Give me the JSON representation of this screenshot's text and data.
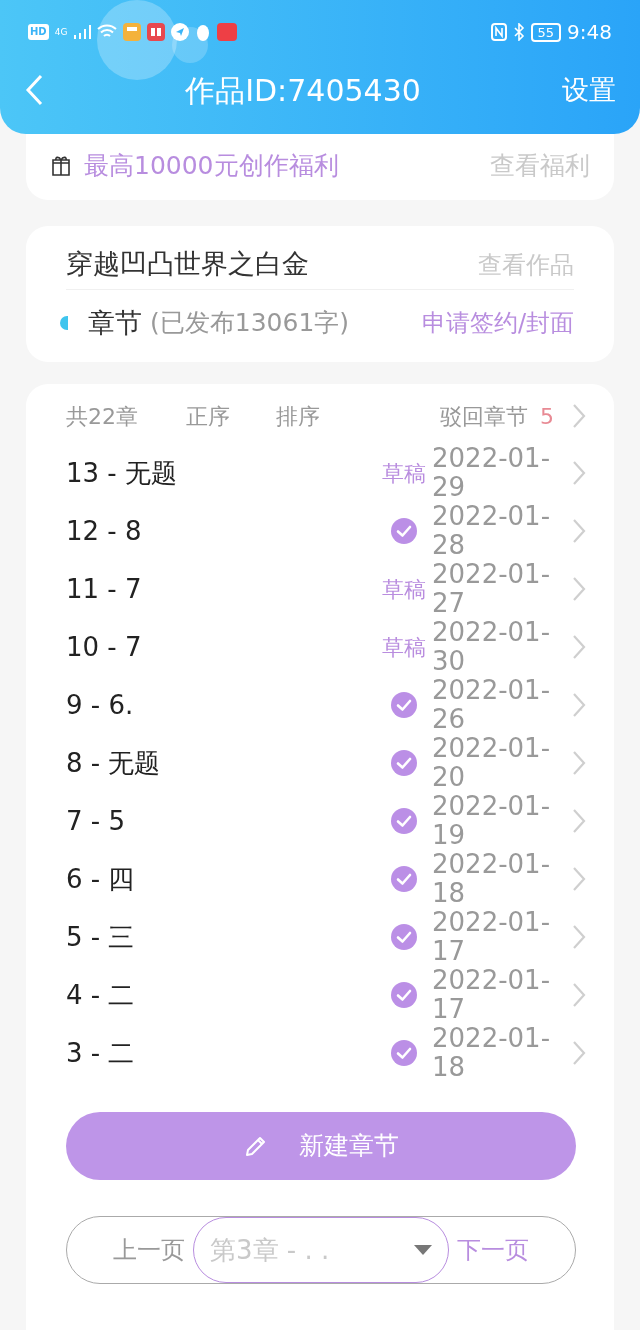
{
  "status_bar": {
    "time": "9:48",
    "battery": "55",
    "network": "4G",
    "hd": "HD"
  },
  "header": {
    "title": "作品ID:7405430",
    "action": "设置"
  },
  "benefit": {
    "text": "最高10000元创作福利",
    "link": "查看福利"
  },
  "work": {
    "title": "穿越凹凸世界之白金",
    "link": "查看作品",
    "section": "章节",
    "published": "(已发布13061字)",
    "apply": "申请签约/封面"
  },
  "chapters_bar": {
    "count": "共22章",
    "order": "正序",
    "sort": "排序",
    "rejected": "驳回章节",
    "rejected_count": "5"
  },
  "chapters": [
    {
      "title": "13 - 无题",
      "kind": "draft",
      "status": "草稿",
      "date": "2022-01-29"
    },
    {
      "title": "12 - 8",
      "kind": "published",
      "date": "2022-01-28"
    },
    {
      "title": "11 - 7",
      "kind": "draft",
      "status": "草稿",
      "date": "2022-01-27"
    },
    {
      "title": "10 - 7",
      "kind": "draft",
      "status": "草稿",
      "date": "2022-01-30"
    },
    {
      "title": "9 - 6.",
      "kind": "published",
      "date": "2022-01-26"
    },
    {
      "title": "8 - 无题",
      "kind": "published",
      "date": "2022-01-20"
    },
    {
      "title": "7 - 5",
      "kind": "published",
      "date": "2022-01-19"
    },
    {
      "title": "6 - 四",
      "kind": "published",
      "date": "2022-01-18"
    },
    {
      "title": "5 - 三",
      "kind": "published",
      "date": "2022-01-17"
    },
    {
      "title": "4 - 二",
      "kind": "published",
      "date": "2022-01-17"
    },
    {
      "title": "3 - 二",
      "kind": "published",
      "date": "2022-01-18"
    }
  ],
  "new_chapter": "新建章节",
  "pager": {
    "prev": "上一页",
    "current": "第3章 - . .",
    "next": "下一页"
  }
}
